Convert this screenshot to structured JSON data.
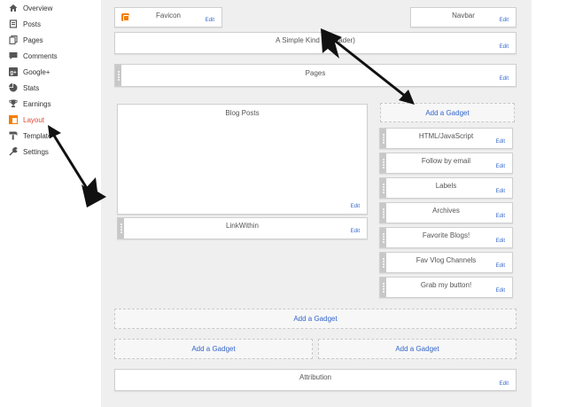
{
  "sidebar": {
    "items": [
      {
        "label": "Overview",
        "icon": "home-icon"
      },
      {
        "label": "Posts",
        "icon": "posts-icon"
      },
      {
        "label": "Pages",
        "icon": "pages-icon"
      },
      {
        "label": "Comments",
        "icon": "comments-icon"
      },
      {
        "label": "Google+",
        "icon": "google-plus-icon"
      },
      {
        "label": "Stats",
        "icon": "stats-icon"
      },
      {
        "label": "Earnings",
        "icon": "trophy-icon"
      },
      {
        "label": "Layout",
        "icon": "layout-icon",
        "active": true
      },
      {
        "label": "Template",
        "icon": "template-icon"
      },
      {
        "label": "Settings",
        "icon": "wrench-icon"
      }
    ]
  },
  "layout": {
    "favicon": {
      "title": "Favicon",
      "edit": "Edit"
    },
    "navbar": {
      "title": "Navbar",
      "edit": "Edit"
    },
    "header": {
      "title": "A Simple Kind of Reader)",
      "edit": "Edit"
    },
    "pages": {
      "title": "Pages",
      "edit": "Edit"
    },
    "blog_posts": {
      "title": "Blog Posts",
      "edit": "Edit"
    },
    "linkwithin": {
      "title": "LinkWithin",
      "edit": "Edit"
    },
    "sidebar_add": "Add a Gadget",
    "sidebar_gadgets": [
      {
        "title": "HTML/JavaScript",
        "edit": "Edit"
      },
      {
        "title": "Follow by email",
        "edit": "Edit"
      },
      {
        "title": "Labels",
        "edit": "Edit"
      },
      {
        "title": "Archives",
        "edit": "Edit"
      },
      {
        "title": "Favorite Blogs!",
        "edit": "Edit"
      },
      {
        "title": "Fav Vlog Channels",
        "edit": "Edit"
      },
      {
        "title": "Grab my button!",
        "edit": "Edit"
      }
    ],
    "footer_add": "Add a Gadget",
    "footer_add_left": "Add a Gadget",
    "footer_add_right": "Add a Gadget",
    "attribution": {
      "title": "Attribution",
      "edit": "Edit"
    }
  },
  "colors": {
    "accent_active": "#dd4b39",
    "link": "#3366cc",
    "canvas": "#efefef"
  }
}
